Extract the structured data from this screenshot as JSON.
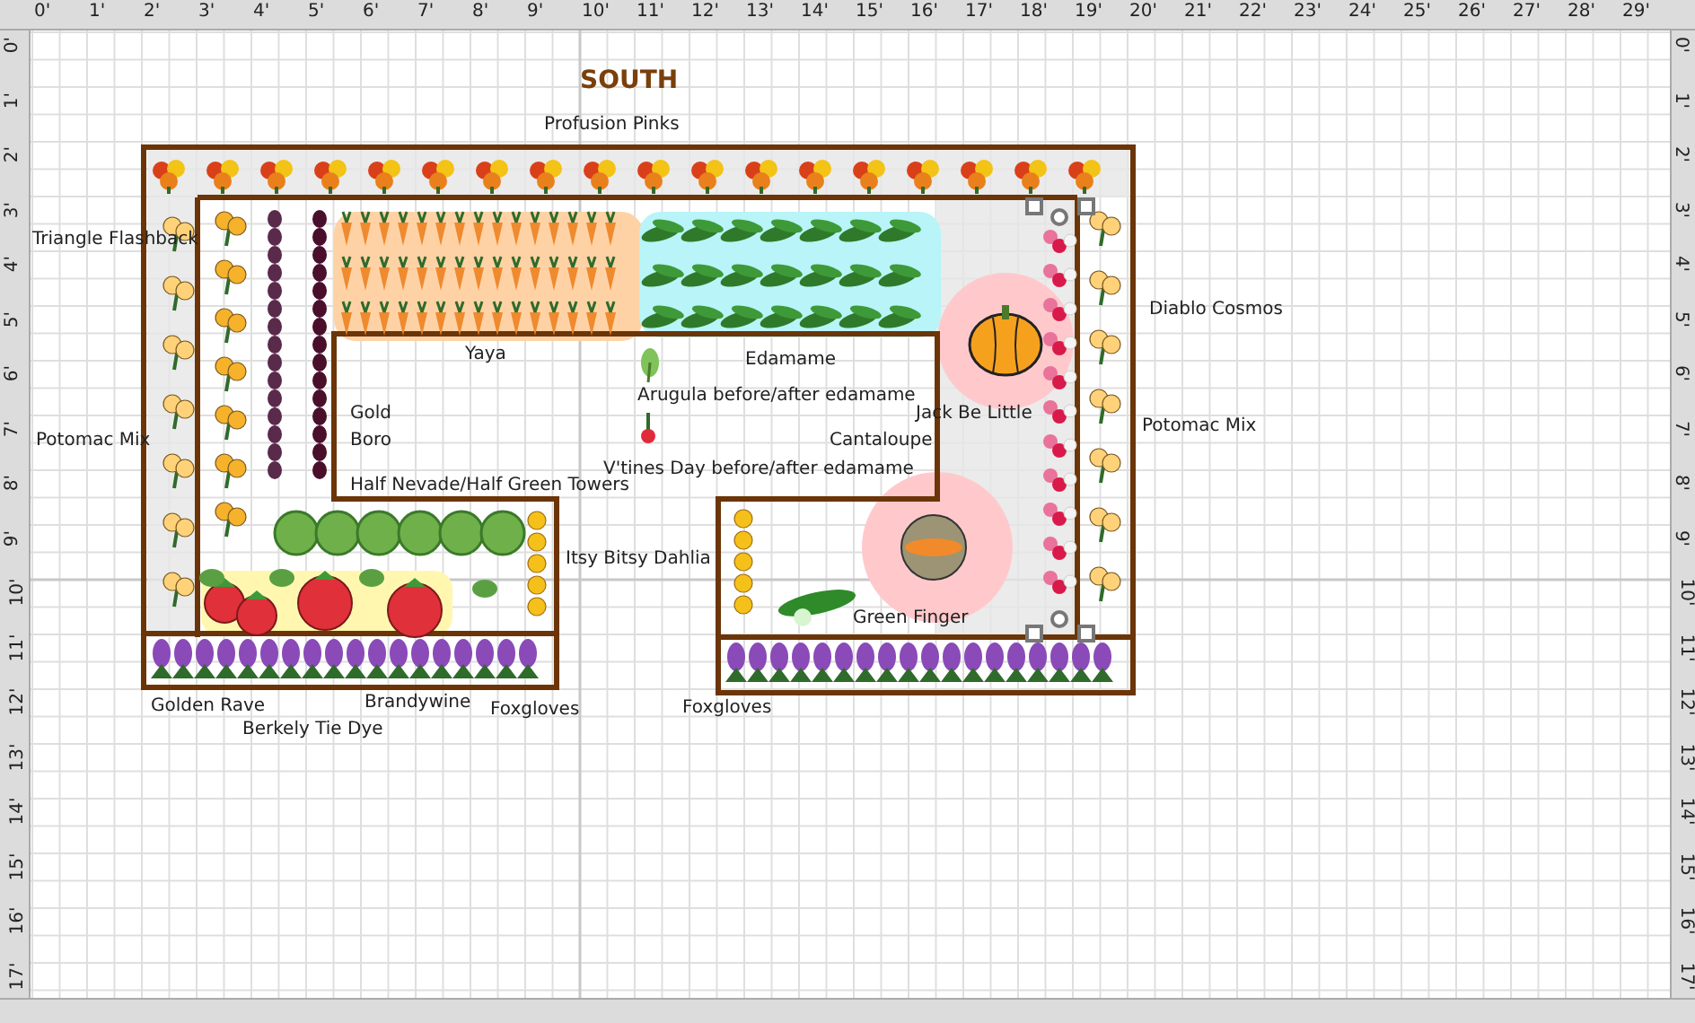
{
  "title": "SOUTH",
  "rulers": {
    "top": [
      "0'",
      "1'",
      "2'",
      "3'",
      "4'",
      "5'",
      "6'",
      "7'",
      "8'",
      "9'",
      "10'",
      "11'",
      "12'",
      "13'",
      "14'",
      "15'",
      "16'",
      "17'",
      "18'",
      "19'",
      "20'",
      "21'",
      "22'",
      "23'",
      "24'",
      "25'",
      "26'",
      "27'",
      "28'",
      "29'"
    ],
    "left": [
      "0'",
      "1'",
      "2'",
      "3'",
      "4'",
      "5'",
      "6'",
      "7'",
      "8'",
      "9'",
      "10'",
      "11'",
      "12'",
      "13'",
      "14'",
      "15'",
      "16'",
      "17'"
    ],
    "right": [
      "0'",
      "1'",
      "2'",
      "3'",
      "4'",
      "5'",
      "6'",
      "7'",
      "8'",
      "9'",
      "10'",
      "11'",
      "12'",
      "13'",
      "14'",
      "15'",
      "16'",
      "17'"
    ]
  },
  "labels": [
    "Profusion Pinks",
    "Triangle Flashback",
    "Diablo Cosmos",
    "Yaya",
    "Edamame",
    "Arugula before/after edamame",
    "Gold",
    "Jack Be Little",
    "Potomac Mix",
    "Potomac Mix",
    "Boro",
    "Cantaloupe",
    "V'tines Day before/after edamame",
    "Half Nevade/Half Green Towers",
    "Itsy Bitsy Dahlia",
    "Green Finger",
    "Golden Rave",
    "Brandywine",
    "Foxgloves",
    "Foxgloves",
    "Berkely Tie Dye"
  ]
}
